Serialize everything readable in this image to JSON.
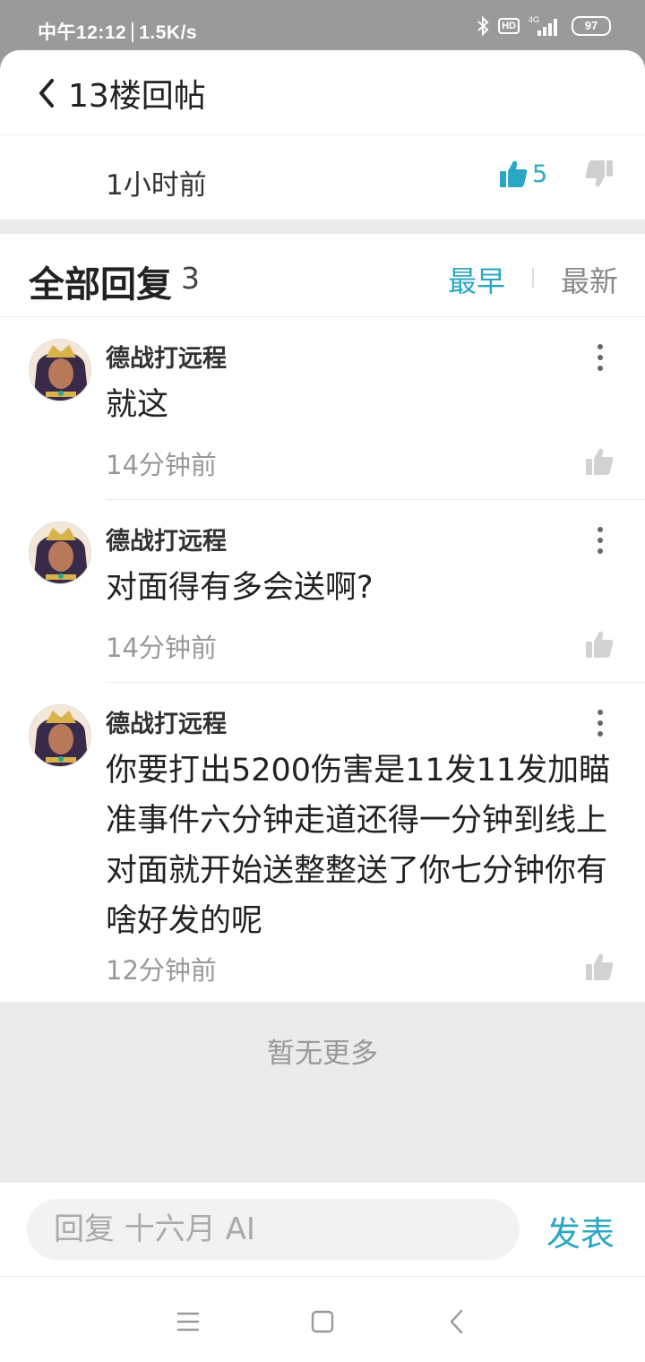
{
  "status_bar": {
    "time": "中午12:12",
    "speed": "1.5K/s",
    "hd": "HD",
    "net": "4G",
    "battery": "97"
  },
  "header": {
    "title": "13楼回帖"
  },
  "post": {
    "time": "1小时前",
    "likes": "5"
  },
  "replies": {
    "title": "全部回复",
    "count": "3",
    "sort_earliest": "最早",
    "sort_newest": "最新"
  },
  "comments": [
    {
      "user": "德战打远程",
      "text": "就这",
      "time": "14分钟前"
    },
    {
      "user": "德战打远程",
      "text": "对面得有多会送啊?",
      "time": "14分钟前"
    },
    {
      "user": "德战打远程",
      "text": "你要打出5200伤害是11发11发加瞄准事件六分钟走道还得一分钟到线上对面就开始送整整送了你七分钟你有啥好发的呢",
      "time": "12分钟前"
    }
  ],
  "footer": {
    "no_more": "暂无更多"
  },
  "reply_bar": {
    "placeholder": "回复 十六月 AI",
    "send_label": "发表"
  },
  "colors": {
    "accent": "#2ba7c4",
    "status_bar_bg": "#9a9a9a"
  },
  "icons": {
    "back": "chevron-left-icon",
    "like": "thumbs-up-icon",
    "dislike": "thumbs-down-icon",
    "more": "more-vertical-icon",
    "bluetooth": "bluetooth-icon",
    "signal": "signal-icon"
  }
}
